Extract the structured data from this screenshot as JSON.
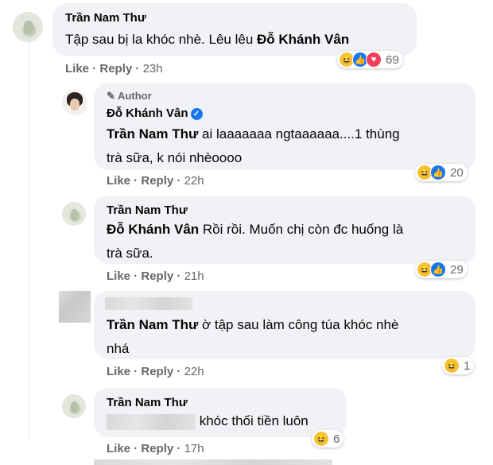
{
  "comments": [
    {
      "name": "Trần Nam Thư",
      "text": "Tập sau bị la khóc nhè. Lêu lêu ",
      "tag": "Đỗ Khánh Vân",
      "like": "Like",
      "reply": "Reply",
      "time": "23h",
      "reactions": [
        "haha",
        "like",
        "love"
      ],
      "count": "69"
    },
    {
      "author_label": "Author",
      "name": "Đỗ Khánh Vân",
      "tag": "Trần Nam Thư",
      "text_line1": " ai laaaaaaa ngtaaaaaa....1 thùng",
      "text_line2": "trà sữa, k nói nhèoooo",
      "like": "Like",
      "reply": "Reply",
      "time": "22h",
      "reactions": [
        "haha",
        "like"
      ],
      "count": "20"
    },
    {
      "name": "Trần Nam Thư",
      "tag": "Đỗ Khánh Vân",
      "text_line1": " Rồi rồi. Muốn chị còn đc huống là",
      "text_line2": "trà sữa.",
      "like": "Like",
      "reply": "Reply",
      "time": "21h",
      "reactions": [
        "haha",
        "like"
      ],
      "count": "29"
    },
    {
      "tag": "Trần Nam Thư",
      "text_line1": " ờ tập sau làm công túa khóc nhè",
      "text_line2": "nhá",
      "like": "Like",
      "reply": "Reply",
      "time": "22h",
      "reactions": [
        "haha"
      ],
      "count": "1"
    },
    {
      "name": "Trần Nam Thư",
      "text": " khóc thối tiền luôn",
      "like": "Like",
      "reply": "Reply",
      "time": "17h",
      "reactions": [
        "haha"
      ],
      "count": "6"
    }
  ],
  "icons": {
    "haha": "😆",
    "like": "👍",
    "love": "♥",
    "verified": "✓",
    "pencil": "✎"
  },
  "colors": {
    "bubble": "#f0f2f5",
    "meta": "#65676b",
    "like_blue": "#1877f2",
    "love_red": "#f33e58",
    "haha_yellow": "#f7c23c"
  }
}
